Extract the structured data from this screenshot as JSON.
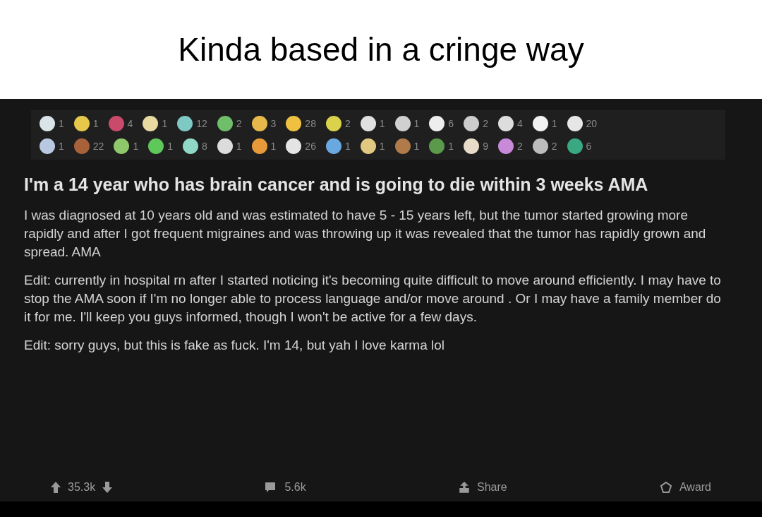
{
  "caption": "Kinda based in a cringe way",
  "awards": [
    [
      {
        "count": "1",
        "color": "#d8e4e6"
      },
      {
        "count": "1",
        "color": "#e6c84a"
      },
      {
        "count": "4",
        "color": "#c94a6a"
      },
      {
        "count": "1",
        "color": "#e8d9a0"
      },
      {
        "count": "12",
        "color": "#7fc9c4"
      },
      {
        "count": "2",
        "color": "#6fbf6a"
      },
      {
        "count": "3",
        "color": "#e8b84a"
      },
      {
        "count": "28",
        "color": "#f0c040"
      },
      {
        "count": "2",
        "color": "#d9d24a"
      },
      {
        "count": "1",
        "color": "#e0e0e0"
      },
      {
        "count": "1",
        "color": "#d0d0d0"
      },
      {
        "count": "6",
        "color": "#eeeeee"
      },
      {
        "count": "2",
        "color": "#cccccc"
      },
      {
        "count": "4",
        "color": "#dddddd"
      },
      {
        "count": "1",
        "color": "#f2f2f2"
      },
      {
        "count": "20",
        "color": "#e6e6e6"
      }
    ],
    [
      {
        "count": "1",
        "color": "#b8c8e0"
      },
      {
        "count": "22",
        "color": "#a8623a"
      },
      {
        "count": "1",
        "color": "#8fc86a"
      },
      {
        "count": "1",
        "color": "#5fc85a"
      },
      {
        "count": "8",
        "color": "#8fd8c8"
      },
      {
        "count": "1",
        "color": "#dcdcdc"
      },
      {
        "count": "1",
        "color": "#e89a3a"
      },
      {
        "count": "26",
        "color": "#e4e4e4"
      },
      {
        "count": "1",
        "color": "#6aa8e0"
      },
      {
        "count": "1",
        "color": "#e0c880"
      },
      {
        "count": "1",
        "color": "#b07a4a"
      },
      {
        "count": "1",
        "color": "#5a9a4a"
      },
      {
        "count": "9",
        "color": "#e8dcc8"
      },
      {
        "count": "2",
        "color": "#c88ad8"
      },
      {
        "count": "2",
        "color": "#bcbcbc"
      },
      {
        "count": "6",
        "color": "#3aa880"
      }
    ]
  ],
  "post": {
    "title": "I'm a 14 year who has brain cancer and is going to die within 3 weeks AMA",
    "paragraphs": [
      "I was diagnosed at 10 years old and was estimated to have 5 - 15 years left, but the tumor started growing more rapidly and after I got frequent migraines and was throwing up it was revealed that the tumor has rapidly grown and spread. AMA",
      "Edit: currently in hospital rn after I started noticing it's becoming quite difficult to move around efficiently. I may have to stop the AMA soon if I'm no longer able to process language and/or move around . Or I may have a family member do it for me. I'll keep you guys informed, though I won't be active for a few days.",
      "Edit: sorry guys, but this is fake as fuck. I'm 14, but yah I love karma lol"
    ]
  },
  "actions": {
    "score": "35.3k",
    "comments": "5.6k",
    "share": "Share",
    "award": "Award"
  }
}
